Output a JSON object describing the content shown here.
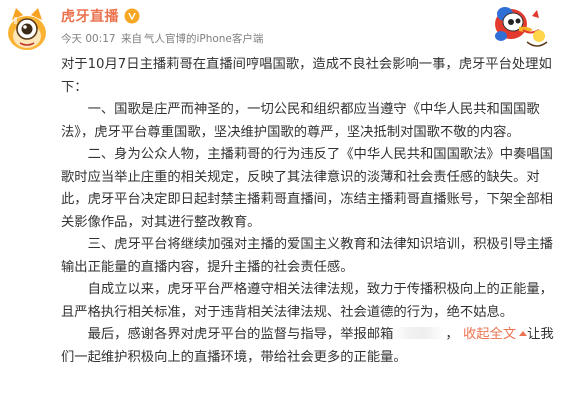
{
  "post": {
    "author": "虎牙直播",
    "colors": {
      "accent": "#eb7350",
      "verified": "#f5a623",
      "text": "#333333",
      "meta": "#808080"
    },
    "meta": {
      "time": "今天 00:17",
      "source_prefix": "来自",
      "source": "气人官博的iPhone客户端"
    },
    "body": {
      "intro": "对于10月7日主播莉哥在直播间哼唱国歌，造成不良社会影响一事，虎牙平台处理如下：",
      "para1": "一、国歌是庄严而神圣的，一切公民和组织都应当遵守《中华人民共和国国歌法》，虎牙平台尊重国歌，坚决维护国歌的尊严，坚决抵制对国歌不敬的内容。",
      "para2": "二、身为公众人物，主播莉哥的行为违反了《中华人民共和国国歌法》中奏唱国歌时应当举止庄重的相关规定，反映了其法律意识的淡薄和社会责任感的缺失。对此，虎牙平台决定即日起封禁主播莉哥直播间，冻结主播莉哥直播账号，下架全部相关影像作品，对其进行整改教育。",
      "para3": "三、虎牙平台将继续加强对主播的爱国主义教育和法律知识培训，积极引导主播输出正能量的直播内容，提升主播的社会责任感。",
      "para4": "自成立以来，虎牙平台严格遵守相关法律法规，致力于传播积极向上的正能量，且严格执行相关标准，对于违背相关法律法规、社会道德的行为，绝不姑息。",
      "para5_start": "最后，感谢各界对虎牙平台的监督与指导，举报邮箱",
      "para5_mid": "，",
      "collapse_label": "收起全文",
      "para5_end": "让我们一起维护积极向上的直播环境，带给社会更多的正能量。"
    },
    "icons": {
      "avatar": "huya-mascot-avatar",
      "verified": "verified-v-icon",
      "sticker": "duck-sticker-icon",
      "collapse": "chevron-up-icon"
    }
  }
}
